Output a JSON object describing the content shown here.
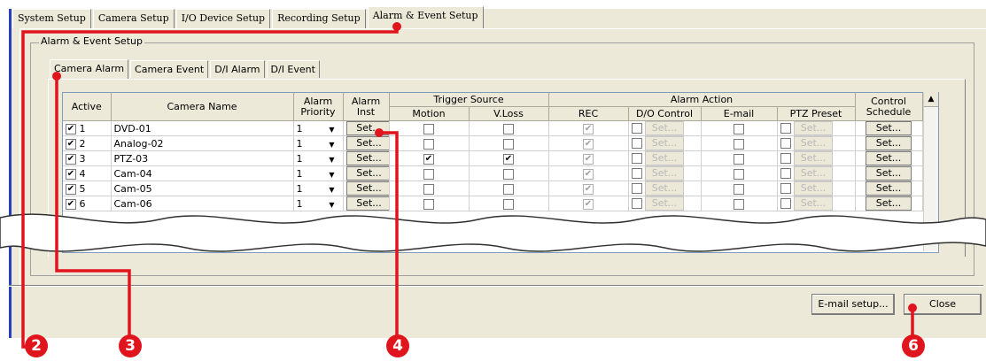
{
  "top_tabs": [
    {
      "label": "System Setup"
    },
    {
      "label": "Camera Setup"
    },
    {
      "label": "I/O Device Setup"
    },
    {
      "label": "Recording Setup"
    },
    {
      "label": "Alarm & Event Setup"
    }
  ],
  "group_title": "Alarm & Event Setup",
  "inner_tabs": [
    {
      "label": "Camera Alarm"
    },
    {
      "label": "Camera Event"
    },
    {
      "label": "D/I Alarm"
    },
    {
      "label": "D/I Event"
    }
  ],
  "headers": {
    "active": "Active",
    "camera_name": "Camera Name",
    "alarm_priority": "Alarm Priority",
    "alarm_inst": "Alarm Inst",
    "trigger_source": "Trigger Source",
    "motion": "Motion",
    "vloss": "V.Loss",
    "alarm_action": "Alarm Action",
    "rec": "REC",
    "do_control": "D/O Control",
    "email": "E-mail",
    "ptz_preset": "PTZ Preset",
    "control_schedule": "Control Schedule"
  },
  "rows": [
    {
      "num": "1",
      "name": "DVD-01",
      "priority": "1",
      "motion": false,
      "vloss": false
    },
    {
      "num": "2",
      "name": "Analog-02",
      "priority": "1",
      "motion": false,
      "vloss": false
    },
    {
      "num": "3",
      "name": "PTZ-03",
      "priority": "1",
      "motion": true,
      "vloss": true
    },
    {
      "num": "4",
      "name": "Cam-04",
      "priority": "1",
      "motion": false,
      "vloss": false
    },
    {
      "num": "5",
      "name": "Cam-05",
      "priority": "1",
      "motion": false,
      "vloss": false
    },
    {
      "num": "6",
      "name": "Cam-06",
      "priority": "1",
      "motion": false,
      "vloss": false
    }
  ],
  "set_label": "Set...",
  "set_disabled_label": "Set...",
  "buttons": {
    "email_setup": "E-mail setup...",
    "close": "Close"
  },
  "callouts": [
    "2",
    "3",
    "4",
    "6"
  ],
  "colors": {
    "callout": "#e0141c",
    "window": "#ece9d8",
    "accent_bar": "#2a3fbf"
  }
}
